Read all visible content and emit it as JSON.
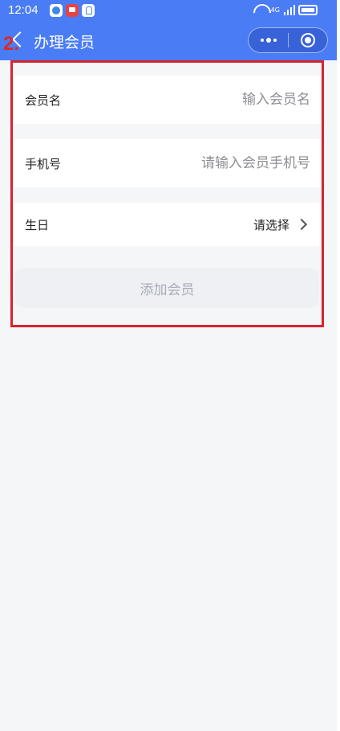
{
  "status_bar": {
    "time": "12:04",
    "network": "4G"
  },
  "nav": {
    "title": "办理会员",
    "annotation_mark": "2."
  },
  "form": {
    "member_name": {
      "label": "会员名",
      "placeholder": "输入会员名"
    },
    "phone": {
      "label": "手机号",
      "placeholder": "请输入会员手机号"
    },
    "birthday": {
      "label": "生日",
      "value": "请选择"
    }
  },
  "submit_label": "添加会员",
  "colors": {
    "nav_bg": "#4a7cf6",
    "page_bg": "#f5f6f8",
    "highlight": "#d8232f",
    "button_bg": "#eef0f4"
  }
}
